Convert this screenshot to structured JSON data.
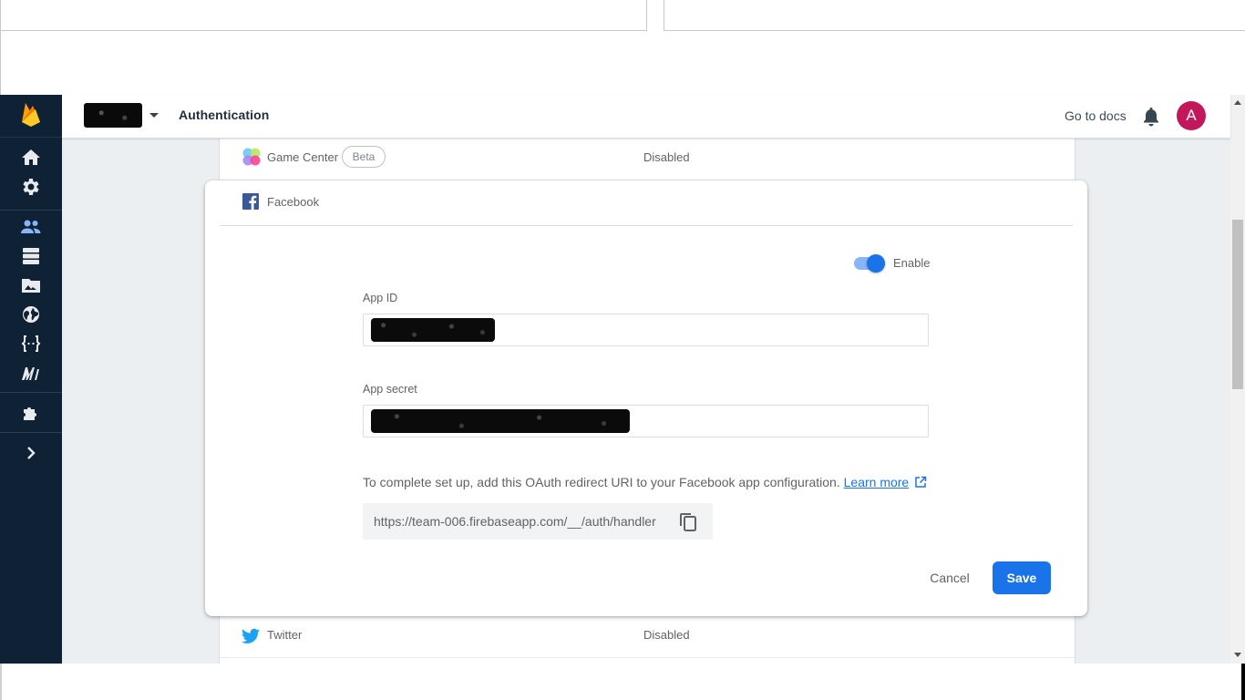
{
  "header": {
    "section_title": "Authentication",
    "go_to_docs": "Go to docs",
    "avatar_initial": "A"
  },
  "sidebar": {
    "items": [
      {
        "icon": "home-icon"
      },
      {
        "icon": "gear-icon"
      },
      {
        "icon": "users-icon",
        "active": true
      },
      {
        "icon": "database-icon"
      },
      {
        "icon": "storage-icon"
      },
      {
        "icon": "globe-icon"
      },
      {
        "icon": "functions-icon"
      },
      {
        "icon": "ml-icon"
      },
      {
        "icon": "extensions-icon"
      },
      {
        "icon": "expand-icon"
      }
    ]
  },
  "providers": {
    "game_center": {
      "name": "Game Center",
      "badge": "Beta",
      "status": "Disabled"
    },
    "twitter": {
      "name": "Twitter",
      "status": "Disabled"
    }
  },
  "dialog": {
    "provider_name": "Facebook",
    "enable_label": "Enable",
    "enabled": true,
    "app_id_label": "App ID",
    "app_secret_label": "App secret",
    "note_text": "To complete set up, add this OAuth redirect URI to your Facebook app configuration.",
    "learn_more": "Learn more",
    "redirect_uri": "https://team-006.firebaseapp.com/__/auth/handler",
    "cancel_label": "Cancel",
    "save_label": "Save"
  },
  "colors": {
    "sidebar_bg": "#0f2134",
    "accent": "#1a73e8",
    "avatar_bg": "#c2185b",
    "content_bg": "#eceff1"
  }
}
